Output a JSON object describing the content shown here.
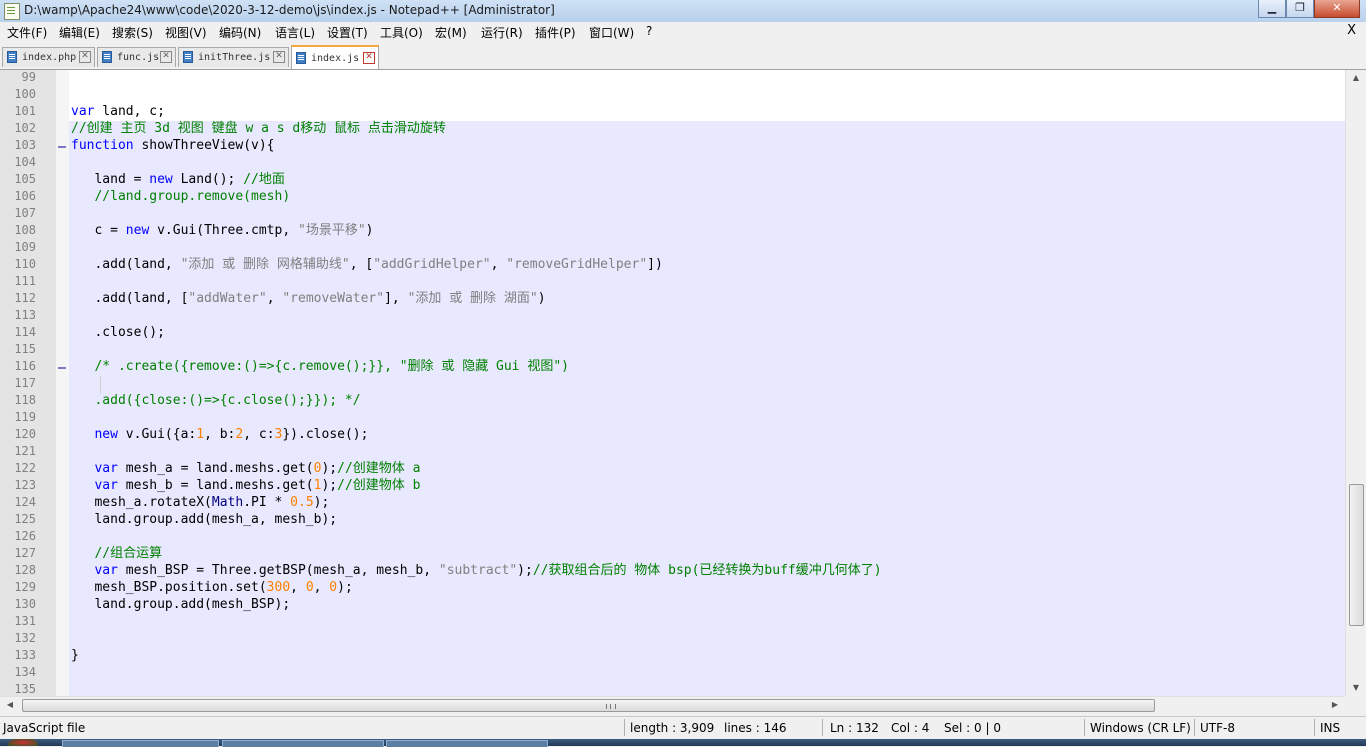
{
  "window": {
    "title": "D:\\wamp\\Apache24\\www\\code\\2020-3-12-demo\\js\\index.js - Notepad++ [Administrator]",
    "min_label": "▁",
    "max_label": "❐",
    "close_label": "✕"
  },
  "menu": {
    "items": [
      "文件(F)",
      "编辑(E)",
      "搜索(S)",
      "视图(V)",
      "编码(N)",
      "语言(L)",
      "设置(T)",
      "工具(O)",
      "宏(M)",
      "运行(R)",
      "插件(P)",
      "窗口(W)",
      "?"
    ],
    "close_label": "X"
  },
  "tabs": [
    {
      "label": "index.php",
      "active": false
    },
    {
      "label": "func.js",
      "active": false
    },
    {
      "label": "initThree.js",
      "active": false
    },
    {
      "label": "index.js",
      "active": true
    }
  ],
  "editor": {
    "current_line": 132,
    "lines": [
      {
        "n": "99",
        "tokens": []
      },
      {
        "n": "100",
        "tokens": []
      },
      {
        "n": "101",
        "tokens": [
          [
            "kw",
            "var"
          ],
          [
            "t",
            " land, c;"
          ]
        ]
      },
      {
        "n": "102",
        "tokens": [
          [
            "cm",
            "//创建 主页 3d 视图 键盘 w a s d移动 鼠标 点击滑动旋转"
          ]
        ]
      },
      {
        "n": "103",
        "tokens": [
          [
            "kw",
            "function"
          ],
          [
            "t",
            " showThreeView(v){"
          ]
        ]
      },
      {
        "n": "104",
        "tokens": []
      },
      {
        "n": "105",
        "tokens": [
          [
            "t",
            "   land = "
          ],
          [
            "kw",
            "new"
          ],
          [
            "t",
            " Land(); "
          ],
          [
            "cm",
            "//地面"
          ]
        ]
      },
      {
        "n": "106",
        "tokens": [
          [
            "cm",
            "   //land.group.remove(mesh)"
          ]
        ]
      },
      {
        "n": "107",
        "tokens": []
      },
      {
        "n": "108",
        "tokens": [
          [
            "t",
            "   c = "
          ],
          [
            "kw",
            "new"
          ],
          [
            "t",
            " v.Gui(Three.cmtp, "
          ],
          [
            "str",
            "\"场景平移\""
          ],
          [
            "t",
            ")"
          ]
        ]
      },
      {
        "n": "109",
        "tokens": []
      },
      {
        "n": "110",
        "tokens": [
          [
            "t",
            "   .add(land, "
          ],
          [
            "str",
            "\"添加 或 删除 网格辅助线\""
          ],
          [
            "t",
            ", ["
          ],
          [
            "str",
            "\"addGridHelper\""
          ],
          [
            "t",
            ", "
          ],
          [
            "str",
            "\"removeGridHelper\""
          ],
          [
            "t",
            "])"
          ]
        ]
      },
      {
        "n": "111",
        "tokens": []
      },
      {
        "n": "112",
        "tokens": [
          [
            "t",
            "   .add(land, ["
          ],
          [
            "str",
            "\"addWater\""
          ],
          [
            "t",
            ", "
          ],
          [
            "str",
            "\"removeWater\""
          ],
          [
            "t",
            "], "
          ],
          [
            "str",
            "\"添加 或 删除 湖面\""
          ],
          [
            "t",
            ")"
          ]
        ]
      },
      {
        "n": "113",
        "tokens": []
      },
      {
        "n": "114",
        "tokens": [
          [
            "t",
            "   .close();"
          ]
        ]
      },
      {
        "n": "115",
        "tokens": []
      },
      {
        "n": "116",
        "tokens": [
          [
            "cm",
            "   /* .create({remove:()=>{c.remove();}}, \"删除 或 隐藏 Gui 视图\")"
          ]
        ]
      },
      {
        "n": "117",
        "tokens": []
      },
      {
        "n": "118",
        "tokens": [
          [
            "cm",
            "   .add({close:()=>{c.close();}}); */"
          ]
        ]
      },
      {
        "n": "119",
        "tokens": []
      },
      {
        "n": "120",
        "tokens": [
          [
            "t",
            "   "
          ],
          [
            "kw",
            "new"
          ],
          [
            "t",
            " v.Gui({a:"
          ],
          [
            "num",
            "1"
          ],
          [
            "t",
            ", b:"
          ],
          [
            "num",
            "2"
          ],
          [
            "t",
            ", c:"
          ],
          [
            "num",
            "3"
          ],
          [
            "t",
            "}).close();"
          ]
        ]
      },
      {
        "n": "121",
        "tokens": []
      },
      {
        "n": "122",
        "tokens": [
          [
            "t",
            "   "
          ],
          [
            "kw",
            "var"
          ],
          [
            "t",
            " mesh_a = land.meshs.get("
          ],
          [
            "num",
            "0"
          ],
          [
            "t",
            ");"
          ],
          [
            "cm",
            "//创建物体 a"
          ]
        ]
      },
      {
        "n": "123",
        "tokens": [
          [
            "t",
            "   "
          ],
          [
            "kw",
            "var"
          ],
          [
            "t",
            " mesh_b = land.meshs.get("
          ],
          [
            "num",
            "1"
          ],
          [
            "t",
            ");"
          ],
          [
            "cm",
            "//创建物体 b"
          ]
        ]
      },
      {
        "n": "124",
        "tokens": [
          [
            "t",
            "   mesh_a.rotateX("
          ],
          [
            "fn",
            "Math"
          ],
          [
            "t",
            ".PI * "
          ],
          [
            "num",
            "0.5"
          ],
          [
            "t",
            ");"
          ]
        ]
      },
      {
        "n": "125",
        "tokens": [
          [
            "t",
            "   land.group.add(mesh_a, mesh_b);"
          ]
        ]
      },
      {
        "n": "126",
        "tokens": []
      },
      {
        "n": "127",
        "tokens": [
          [
            "cm",
            "   //组合运算"
          ]
        ]
      },
      {
        "n": "128",
        "tokens": [
          [
            "t",
            "   "
          ],
          [
            "kw",
            "var"
          ],
          [
            "t",
            " mesh_BSP = Three.getBSP(mesh_a, mesh_b, "
          ],
          [
            "str",
            "\"subtract\""
          ],
          [
            "t",
            ");"
          ],
          [
            "cm",
            "//获取组合后的 物体 bsp(已经转换为buff缓冲几何体了)"
          ]
        ]
      },
      {
        "n": "129",
        "tokens": [
          [
            "t",
            "   mesh_BSP.position.set("
          ],
          [
            "num",
            "300"
          ],
          [
            "t",
            ", "
          ],
          [
            "num",
            "0"
          ],
          [
            "t",
            ", "
          ],
          [
            "num",
            "0"
          ],
          [
            "t",
            ");"
          ]
        ]
      },
      {
        "n": "130",
        "tokens": [
          [
            "t",
            "   land.group.add(mesh_BSP);"
          ]
        ]
      },
      {
        "n": "131",
        "tokens": []
      },
      {
        "n": "132",
        "tokens": []
      },
      {
        "n": "133",
        "tokens": [
          [
            "t",
            "}"
          ]
        ]
      },
      {
        "n": "134",
        "tokens": []
      },
      {
        "n": "135",
        "tokens": []
      }
    ]
  },
  "status": {
    "language": "JavaScript file",
    "length": "length : 3,909",
    "lines": "lines : 146",
    "ln": "Ln : 132",
    "col": "Col : 4",
    "sel": "Sel : 0 | 0",
    "eol": "Windows (CR LF)",
    "encoding": "UTF-8",
    "mode": "INS"
  },
  "colors": {
    "keyword": "#0000ff",
    "comment": "#008000",
    "string": "#808080",
    "number": "#ff8000",
    "current_line_bg": "#e8e8ff",
    "active_tab_accent": "#f8a83b"
  }
}
